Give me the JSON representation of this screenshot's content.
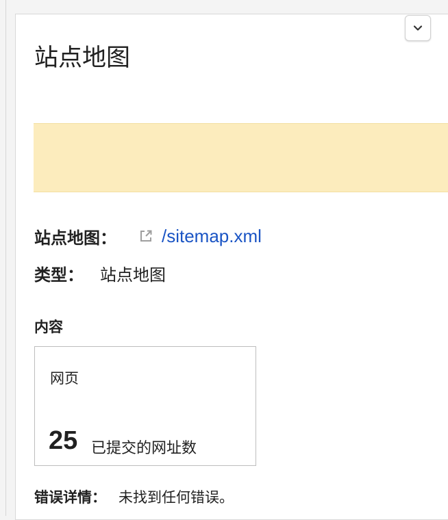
{
  "panel": {
    "title": "站点地图",
    "collapse_icon": "chevron-down-icon"
  },
  "banner": {
    "color": "#fcecbd"
  },
  "details": {
    "sitemap_label": "站点地图：",
    "sitemap_link_icon": "external-link-icon",
    "sitemap_url": "/sitemap.xml",
    "type_label": "类型：",
    "type_value": "站点地图"
  },
  "content": {
    "heading": "内容",
    "card": {
      "title": "网页",
      "count": "25",
      "count_label": "已提交的网址数"
    }
  },
  "errors": {
    "label": "错误详情：",
    "value": "未找到任何错误。"
  },
  "colors": {
    "link": "#1a54c4",
    "text": "#212121"
  }
}
